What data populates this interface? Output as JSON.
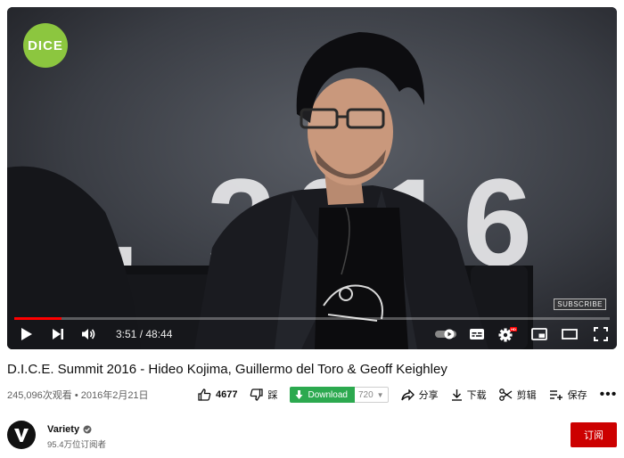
{
  "player": {
    "overlay_logo": "DICE",
    "watermark": "SUBSCRIBE",
    "time_display": "3:51 / 48:44",
    "progress_fraction": 0.079,
    "background_text": "2, 2016"
  },
  "video": {
    "title": "D.I.C.E. Summit 2016 - Hideo Kojima, Guillermo del Toro & Geoff Keighley",
    "views_date": "245,096次观看 • 2016年2月21日"
  },
  "actions": {
    "like_count": "4677",
    "dislike_label": "踩",
    "download_label": "Download",
    "quality_value": "720",
    "share_label": "分享",
    "save_offline_label": "下载",
    "clip_label": "剪辑",
    "save_label": "保存",
    "more_label": "•••"
  },
  "channel": {
    "name": "Variety",
    "subscribers": "95.4万位订阅者",
    "subscribe_label": "订阅",
    "avatar_letter": "V"
  },
  "colors": {
    "progress": "#ff0000",
    "download": "#2ca94f",
    "subscribe": "#cc0000",
    "dice_logo": "#8cc63f"
  }
}
